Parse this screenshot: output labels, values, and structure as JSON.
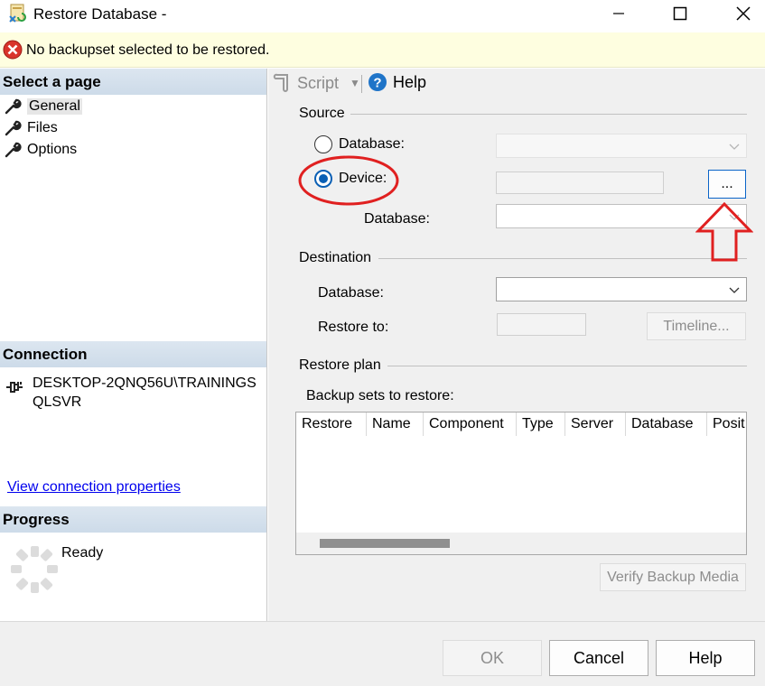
{
  "window": {
    "title": "Restore Database -",
    "controls": {
      "minimize": "minimize",
      "maximize": "maximize",
      "close": "close"
    }
  },
  "banner": {
    "text": "No backupset selected to be restored.",
    "icon": "error-icon",
    "color": "#d9342b"
  },
  "left": {
    "select_page_header": "Select a page",
    "pages": [
      {
        "label": "General",
        "selected": true
      },
      {
        "label": "Files",
        "selected": false
      },
      {
        "label": "Options",
        "selected": false
      }
    ],
    "connection_header": "Connection",
    "connection_text": "DESKTOP-2QNQ56U\\TRAININGSQLSVR",
    "view_connection_link": "View connection properties",
    "progress_header": "Progress",
    "progress_status": "Ready"
  },
  "toolbar": {
    "script_label": "Script",
    "help_label": "Help"
  },
  "source": {
    "group_label": "Source",
    "database_radio_label": "Database:",
    "device_radio_label": "Device:",
    "selected": "Device",
    "device_database_label": "Database:",
    "browse_button_label": "..."
  },
  "destination": {
    "group_label": "Destination",
    "database_label": "Database:",
    "restore_to_label": "Restore to:",
    "timeline_button_label": "Timeline..."
  },
  "restore_plan": {
    "group_label": "Restore plan",
    "backup_sets_label": "Backup sets to restore:",
    "columns": [
      "Restore",
      "Name",
      "Component",
      "Type",
      "Server",
      "Database",
      "Posit"
    ],
    "rows": [],
    "verify_button_label": "Verify Backup Media"
  },
  "footer": {
    "ok_label": "OK",
    "cancel_label": "Cancel",
    "help_label": "Help"
  },
  "colors": {
    "accent": "#0a5fb4",
    "annotation": "#e02020",
    "header_bg": "#cddbe9"
  }
}
